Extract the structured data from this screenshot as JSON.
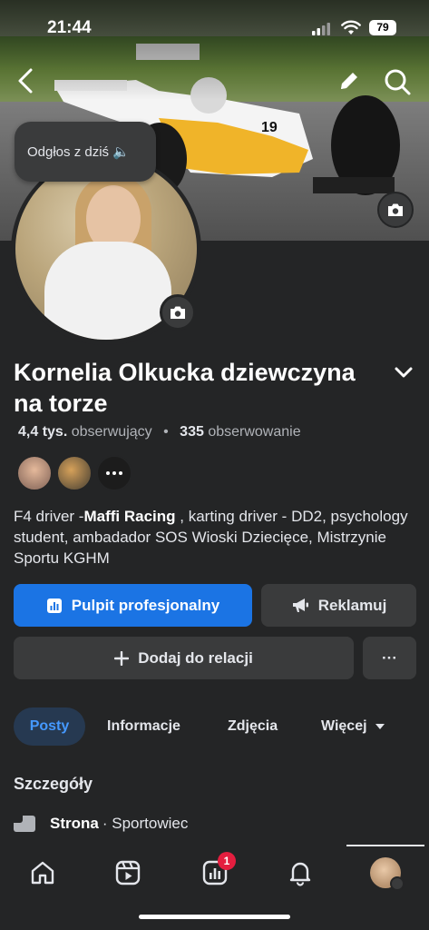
{
  "status_bar": {
    "time": "21:44",
    "battery": "79"
  },
  "cover": {
    "bubble_text": "Odgłos z dziś 🔈"
  },
  "profile": {
    "name": "Kornelia Olkucka  dziewczyna na torze",
    "followers_count": "4,4 tys.",
    "followers_label": "obserwujący",
    "following_count": "335",
    "following_label": "obserwowanie",
    "bio_prefix": "F4 driver -",
    "bio_bold": "Maffi Racing",
    "bio_suffix": " , karting driver - DD2, psychology student, ambadador SOS Wioski Dziecięce, Mistrzynie Sportu KGHM"
  },
  "buttons": {
    "dashboard": "Pulpit profesjonalny",
    "ads": "Reklamuj",
    "add_story": "Dodaj do relacji",
    "more": "···"
  },
  "tabs": [
    {
      "label": "Posty"
    },
    {
      "label": "Informacje"
    },
    {
      "label": "Zdjęcia"
    },
    {
      "label": "Więcej"
    }
  ],
  "details": {
    "title": "Szczegóły",
    "page_label": "Strona",
    "page_category": "· Sportowiec"
  },
  "bottom_nav": {
    "badge_count": "1"
  },
  "colors": {
    "accent": "#1b74e4",
    "background": "#242526",
    "badge": "#e41e3f"
  }
}
